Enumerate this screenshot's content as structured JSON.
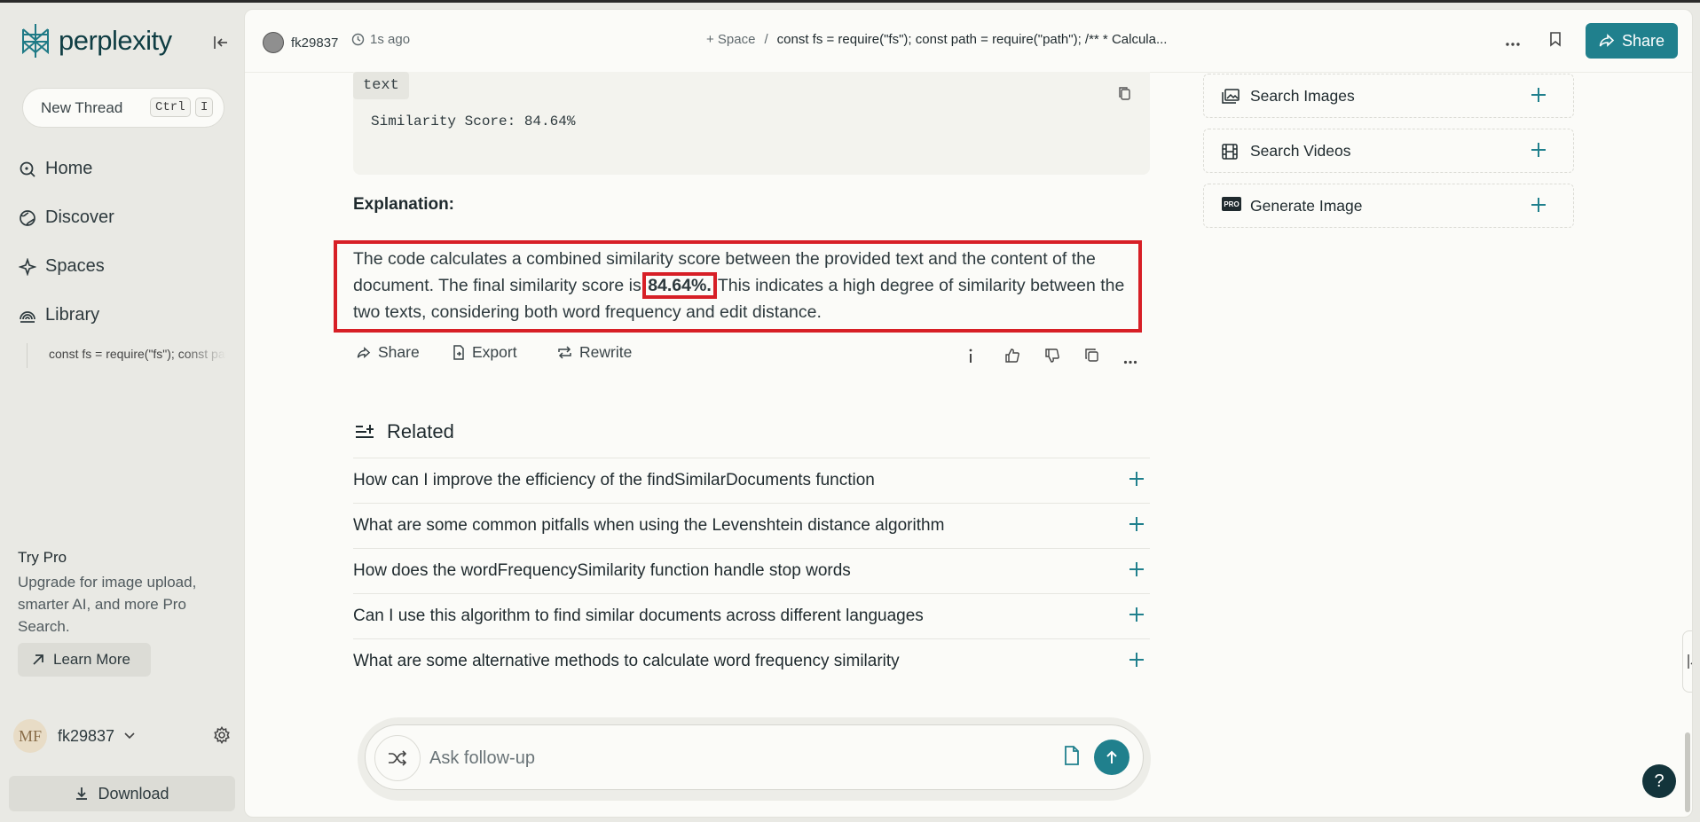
{
  "app": {
    "logo_text": "perplexity"
  },
  "sidebar": {
    "new_thread_label": "New Thread",
    "shortcut_key1": "Ctrl",
    "shortcut_key2": "I",
    "nav": [
      {
        "label": "Home",
        "icon": "home-search-icon"
      },
      {
        "label": "Discover",
        "icon": "globe-icon"
      },
      {
        "label": "Spaces",
        "icon": "spaces-icon"
      },
      {
        "label": "Library",
        "icon": "library-icon"
      }
    ],
    "library_thread": "const fs = require(\"fs\"); const path = require(\"path\");",
    "try_pro_title": "Try Pro",
    "try_pro_desc": "Upgrade for image upload, smarter AI, and more Pro Search.",
    "learn_more_label": "Learn More",
    "user_initials": "MF",
    "username": "fk29837",
    "download_label": "Download"
  },
  "header": {
    "author": "fk29837",
    "time": "1s ago",
    "space_label": "+ Space",
    "separator": "/",
    "thread_title": "const fs = require(\"fs\"); const path = require(\"path\"); /** * Calcula...",
    "share_label": "Share"
  },
  "answer": {
    "code_lang": "text",
    "code_text": "Similarity Score: 84.64%",
    "explanation_heading": "Explanation:",
    "para_part1": "The code calculates a combined similarity score between the provided text and the content of the document. The final similarity score is ",
    "para_highlight": "84.64%.",
    "para_part2": " This indicates a high degree of similarity between the two texts, considering both word frequency and edit distance.",
    "actions": {
      "share": "Share",
      "export": "Export",
      "rewrite": "Rewrite"
    }
  },
  "related": {
    "heading": "Related",
    "items": [
      "How can I improve the efficiency of the findSimilarDocuments function",
      "What are some common pitfalls when using the Levenshtein distance algorithm",
      "How does the wordFrequencySimilarity function handle stop words",
      "Can I use this algorithm to find similar documents across different languages",
      "What are some alternative methods to calculate word frequency similarity"
    ]
  },
  "followup": {
    "placeholder": "Ask follow-up"
  },
  "side_panel": {
    "search_images": "Search Images",
    "search_videos": "Search Videos",
    "generate_image": "Generate Image",
    "pro_badge": "PRO"
  },
  "help_label": "?",
  "colors": {
    "accent": "#20808d",
    "highlight_box": "#d71f26",
    "sidebar_bg": "#e9e9e4",
    "main_bg": "#fbfbf8"
  }
}
